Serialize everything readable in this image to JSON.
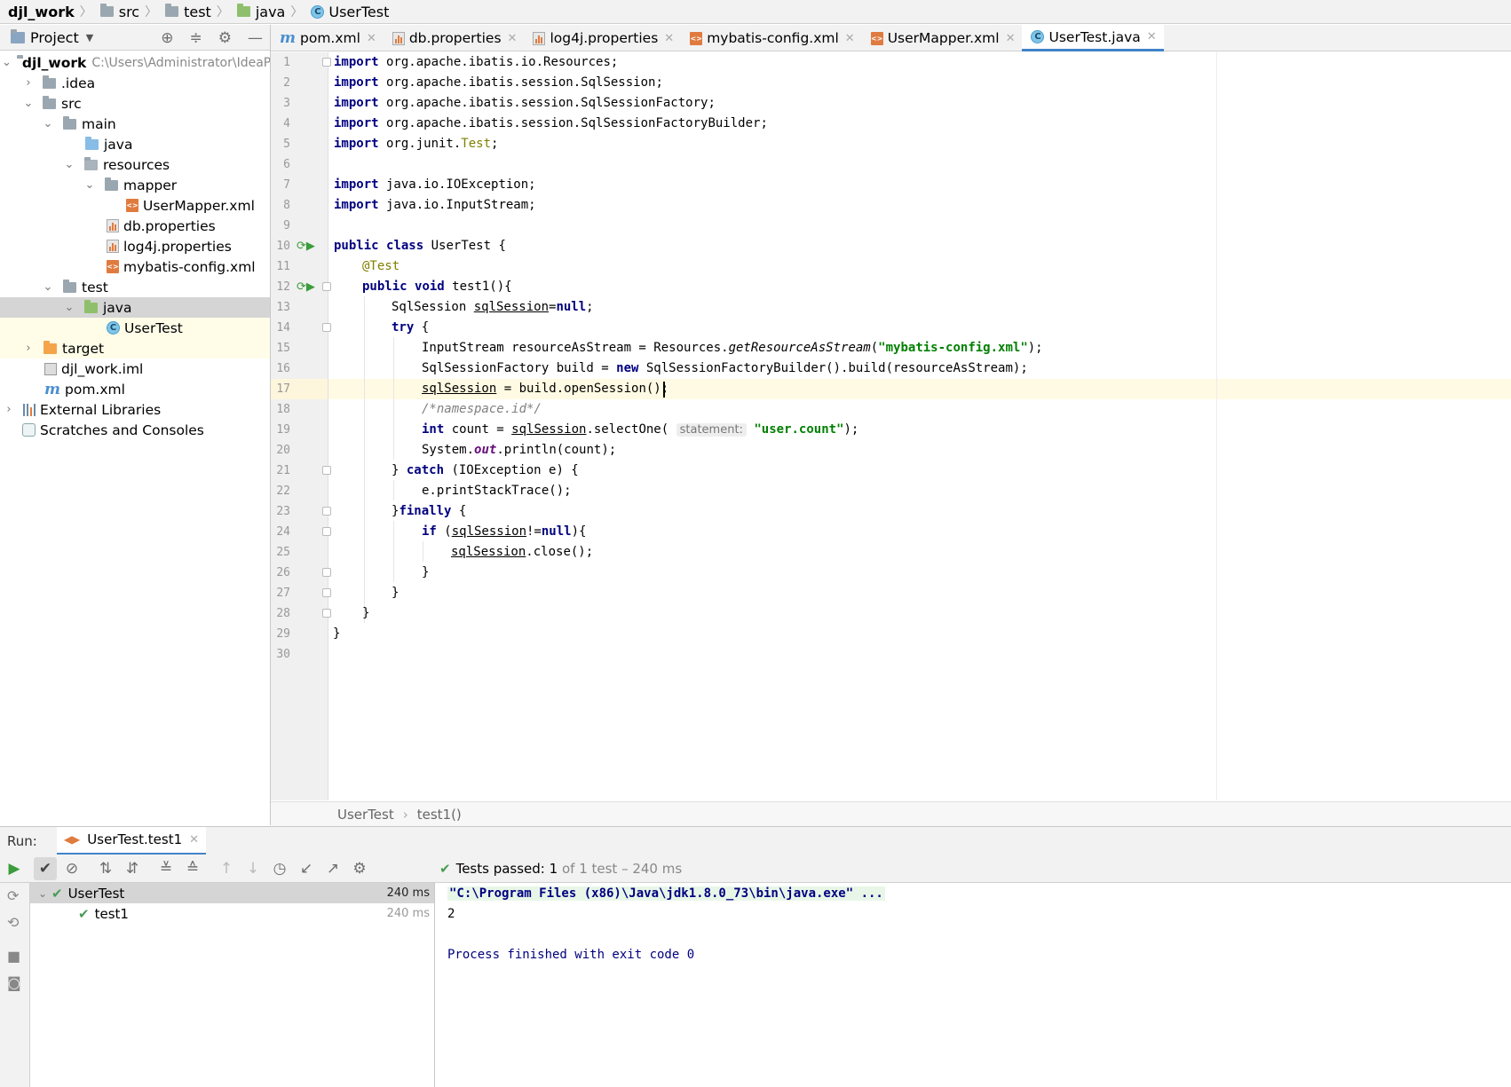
{
  "breadcrumb": {
    "items": [
      "djl_work",
      "src",
      "test",
      "java",
      "UserTest"
    ]
  },
  "project": {
    "title": "Project",
    "root": {
      "name": "djl_work",
      "path": "C:\\Users\\Administrator\\IdeaP"
    },
    "tree": [
      {
        "label": ".idea"
      },
      {
        "label": "src"
      },
      {
        "label": "main"
      },
      {
        "label": "java"
      },
      {
        "label": "resources"
      },
      {
        "label": "mapper"
      },
      {
        "label": "UserMapper.xml"
      },
      {
        "label": "db.properties"
      },
      {
        "label": "log4j.properties"
      },
      {
        "label": "mybatis-config.xml"
      },
      {
        "label": "test"
      },
      {
        "label": "java"
      },
      {
        "label": "UserTest"
      },
      {
        "label": "target"
      },
      {
        "label": "djl_work.iml"
      },
      {
        "label": "pom.xml"
      },
      {
        "label": "External Libraries"
      },
      {
        "label": "Scratches and Consoles"
      }
    ]
  },
  "tabs": [
    {
      "label": "pom.xml"
    },
    {
      "label": "db.properties"
    },
    {
      "label": "log4j.properties"
    },
    {
      "label": "mybatis-config.xml"
    },
    {
      "label": "UserMapper.xml"
    },
    {
      "label": "UserTest.java"
    }
  ],
  "editor": {
    "line_numbers": [
      "1",
      "2",
      "3",
      "4",
      "5",
      "6",
      "7",
      "8",
      "9",
      "10",
      "11",
      "12",
      "13",
      "14",
      "15",
      "16",
      "17",
      "18",
      "19",
      "20",
      "21",
      "22",
      "23",
      "24",
      "25",
      "26",
      "27",
      "28",
      "29",
      "30"
    ],
    "breadcrumb": {
      "class": "UserTest",
      "method": "test1()"
    },
    "code": {
      "l1": {
        "kw": "import",
        "rest": " org.apache.ibatis.io.Resources;"
      },
      "l2": {
        "kw": "import",
        "rest": " org.apache.ibatis.session.SqlSession;"
      },
      "l3": {
        "kw": "import",
        "rest": " org.apache.ibatis.session.SqlSessionFactory;"
      },
      "l4": {
        "kw": "import",
        "rest": " org.apache.ibatis.session.SqlSessionFactoryBuilder;"
      },
      "l5": {
        "kw": "import",
        "rest": " org.junit.",
        "cls": "Test",
        "end": ";"
      },
      "l7": {
        "kw": "import",
        "rest": " java.io.IOException;"
      },
      "l8": {
        "kw": "import",
        "rest": " java.io.InputStream;"
      },
      "l10": {
        "kw1": "public",
        "kw2": "class",
        "rest": " UserTest {"
      },
      "l11": {
        "ann": "@Test"
      },
      "l12": {
        "kw1": "public",
        "kw2": "void",
        "rest": " test1(){"
      },
      "l13": {
        "a": "SqlSession ",
        "var": "sqlSession",
        "b": "=",
        "kw": "null",
        "c": ";"
      },
      "l14": {
        "kw": "try",
        "rest": " {"
      },
      "l15": {
        "a": "InputStream resourceAsStream = Resources.",
        "m": "getResourceAsStream",
        "b": "(",
        "str": "\"mybatis-config.xml\"",
        "c": ");"
      },
      "l16": {
        "a": "SqlSessionFactory build = ",
        "kw": "new",
        "b": " SqlSessionFactoryBuilder().build(resourceAsStream);"
      },
      "l17": {
        "var": "sqlSession",
        "a": " = build.openSession();"
      },
      "l18": {
        "cm": "/*namespace.id*/"
      },
      "l19": {
        "kw": "int",
        "a": " count = ",
        "var": "sqlSession",
        "b": ".selectOne( ",
        "hint": "statement:",
        "str": " \"user.count\"",
        "c": ");"
      },
      "l20": {
        "a": "System.",
        "fld": "out",
        "b": ".println(count);"
      },
      "l21": {
        "a": "} ",
        "kw": "catch",
        "b": " (IOException e) {"
      },
      "l22": {
        "a": "e.printStackTrace();"
      },
      "l23": {
        "a": "}",
        "kw": "finally",
        "b": " {"
      },
      "l24": {
        "kw": "if",
        "a": " (",
        "var": "sqlSession",
        "b": "!=",
        "kw2": "null",
        "c": "){"
      },
      "l25": {
        "var": "sqlSession",
        "a": ".close();"
      },
      "l26": {
        "a": "}"
      },
      "l27": {
        "a": "}"
      },
      "l28": {
        "a": "}"
      },
      "l29": {
        "a": "}"
      }
    }
  },
  "run": {
    "label": "Run:",
    "tab": "UserTest.test1",
    "status": {
      "prefix": "Tests passed:",
      "count": "1",
      "suffix": "of 1 test – 240 ms"
    },
    "tests": [
      {
        "name": "UserTest",
        "time": "240 ms"
      },
      {
        "name": "test1",
        "time": "240 ms"
      }
    ],
    "console": {
      "command": "\"C:\\Program Files (x86)\\Java\\jdk1.8.0_73\\bin\\java.exe\" ...",
      "output": "2",
      "exit": "Process finished with exit code 0"
    }
  },
  "colors": {
    "accent": "#4083c9",
    "keyword": "#000080",
    "string": "#008000",
    "pass": "#499c54"
  }
}
